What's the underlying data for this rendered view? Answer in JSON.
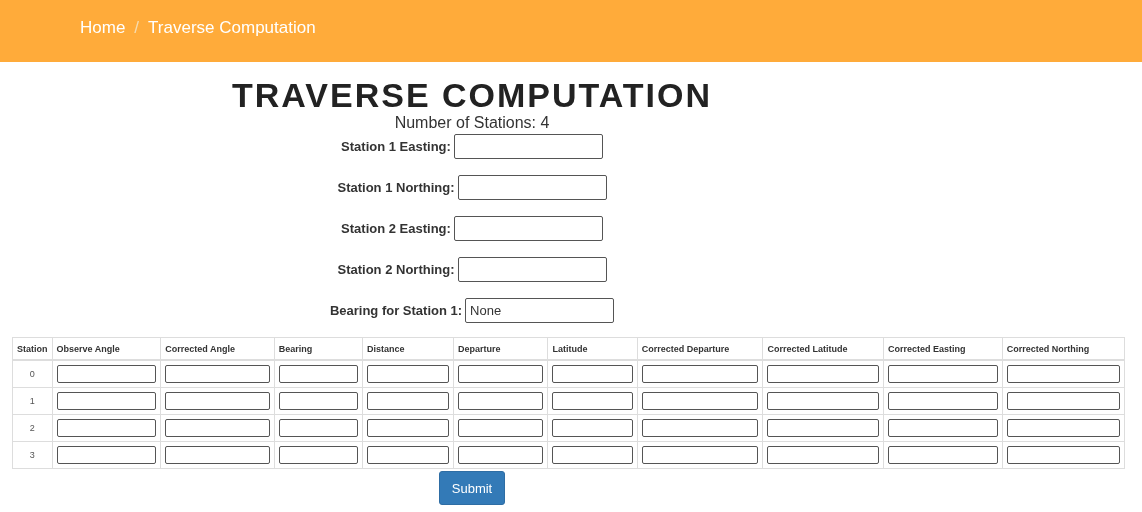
{
  "breadcrumb_separator": "/",
  "breadcrumb": [
    {
      "label": "Home"
    },
    {
      "label": "Traverse Computation"
    }
  ],
  "title": "TRAVERSE COMPUTATION",
  "subtitle": "Number of Stations: 4",
  "fields": [
    {
      "label": "Station 1 Easting:"
    },
    {
      "label": "Station 1 Northing:"
    },
    {
      "label": "Station 2 Easting:"
    },
    {
      "label": "Station 2 Northing:"
    },
    {
      "label": "Bearing for Station 1:",
      "value": "None"
    }
  ],
  "table": {
    "columns": [
      "Station",
      "Observe Angle",
      "Corrected Angle",
      "Bearing",
      "Distance",
      "Departure",
      "Latitude",
      "Corrected Departure",
      "Corrected Latitude",
      "Corrected Easting",
      "Corrected Northing"
    ],
    "rows": [
      {
        "station": "0"
      },
      {
        "station": "1"
      },
      {
        "station": "2"
      },
      {
        "station": "3"
      }
    ]
  },
  "submit": "Submit"
}
